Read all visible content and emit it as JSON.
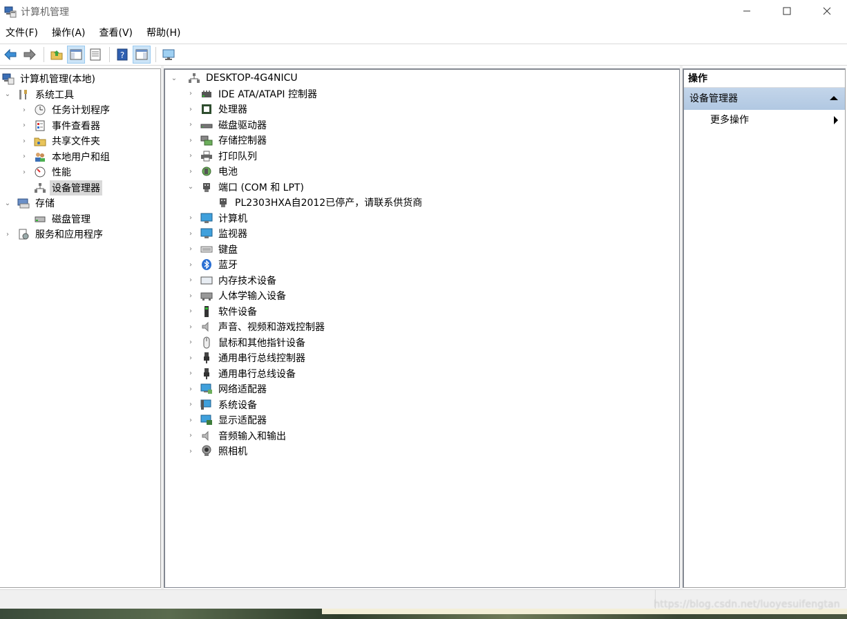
{
  "window": {
    "title": "计算机管理"
  },
  "menu": {
    "items": [
      "文件(F)",
      "操作(A)",
      "查看(V)",
      "帮助(H)"
    ]
  },
  "toolbar": {
    "buttons": [
      "back-icon",
      "forward-icon",
      "up-folder-icon",
      "show-hide-console-tree-icon",
      "properties-icon",
      "help-icon",
      "show-hide-action-pane-icon",
      "monitor-icon"
    ]
  },
  "left_tree": {
    "root": "计算机管理(本地)",
    "system_tools": "系统工具",
    "task_scheduler": "任务计划程序",
    "event_viewer": "事件查看器",
    "shared_folders": "共享文件夹",
    "local_users": "本地用户和组",
    "performance": "性能",
    "device_manager": "设备管理器",
    "storage": "存储",
    "disk_management": "磁盘管理",
    "services": "服务和应用程序"
  },
  "device_tree": {
    "computer": "DESKTOP-4G4NICU",
    "categories": [
      "IDE ATA/ATAPI 控制器",
      "处理器",
      "磁盘驱动器",
      "存储控制器",
      "打印队列",
      "电池",
      "端口 (COM 和 LPT)",
      "PL2303HXA自2012已停产，请联系供货商",
      "计算机",
      "监视器",
      "键盘",
      "蓝牙",
      "内存技术设备",
      "人体学输入设备",
      "软件设备",
      "声音、视频和游戏控制器",
      "鼠标和其他指针设备",
      "通用串行总线控制器",
      "通用串行总线设备",
      "网络适配器",
      "系统设备",
      "显示适配器",
      "音频输入和输出",
      "照相机"
    ]
  },
  "actions": {
    "header": "操作",
    "section": "设备管理器",
    "more": "更多操作"
  },
  "watermark": "https://blog.csdn.net/luoyesuifengtan"
}
